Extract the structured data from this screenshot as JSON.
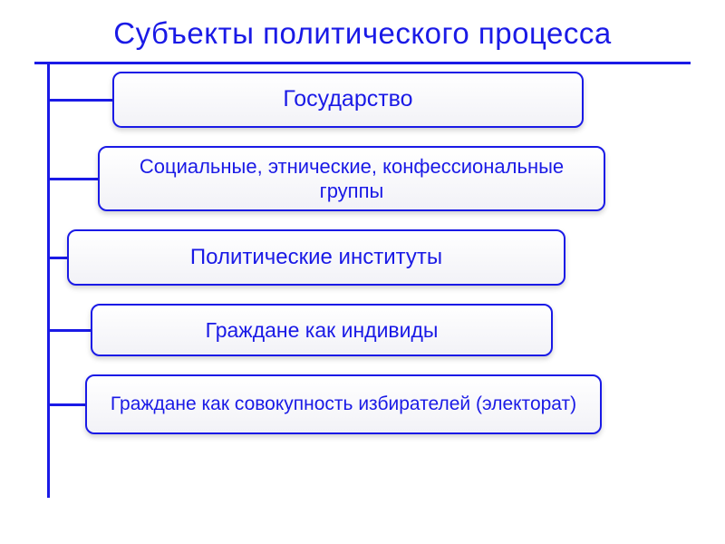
{
  "title": "Субъекты политического процесса",
  "chart_data": {
    "type": "diagram",
    "title": "Субъекты политического процесса",
    "items": [
      "Государство",
      "Социальные, этнические, конфессиональные группы",
      "Политические институты",
      "Граждане как индивиды",
      "Граждане как совокупность избирателей (электорат)"
    ]
  },
  "nodes": {
    "n1": "Государство",
    "n2": "Социальные, этнические, конфессиональные группы",
    "n3": "Политические институты",
    "n4": "Граждане как индивиды",
    "n5": "Граждане как совокупность избирателей (электорат)"
  }
}
